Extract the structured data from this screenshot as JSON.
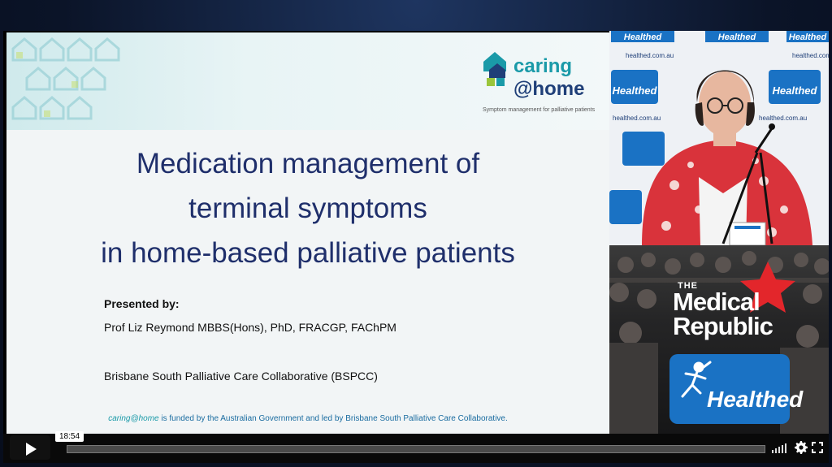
{
  "slide": {
    "brand_line1": "caring",
    "brand_line2": "@home",
    "brand_tagline": "Symptom management for palliative patients",
    "title_line1": "Medication management of",
    "title_line2": "terminal symptoms",
    "title_line3": "in home-based palliative patients",
    "presented_label": "Presented by:",
    "presenter": "Prof Liz Reymond MBBS(Hons), PhD, FRACGP, FAChPM",
    "organization": "Brisbane South Palliative Care Collaborative (BSPCC)",
    "footer_brand": "caring@home",
    "footer_text": " is funded by the Australian Government and led by Brisbane South Palliative Care Collaborative."
  },
  "backdrop": {
    "brand": "Healthed",
    "url": "healthed.com.au"
  },
  "overlays": {
    "mr_the": "THE",
    "mr_line1": "Medical",
    "mr_line2": "Republic",
    "healthed": "Healthed"
  },
  "player": {
    "time": "18:54",
    "progress": 0.0,
    "icons": [
      "play-icon",
      "volume-icon",
      "gear-icon",
      "fullscreen-icon"
    ]
  },
  "colors": {
    "title": "#1f2f6b",
    "brand_teal": "#1a9aa8",
    "healthed_blue": "#1a72c4",
    "mr_red": "#e3262b"
  }
}
